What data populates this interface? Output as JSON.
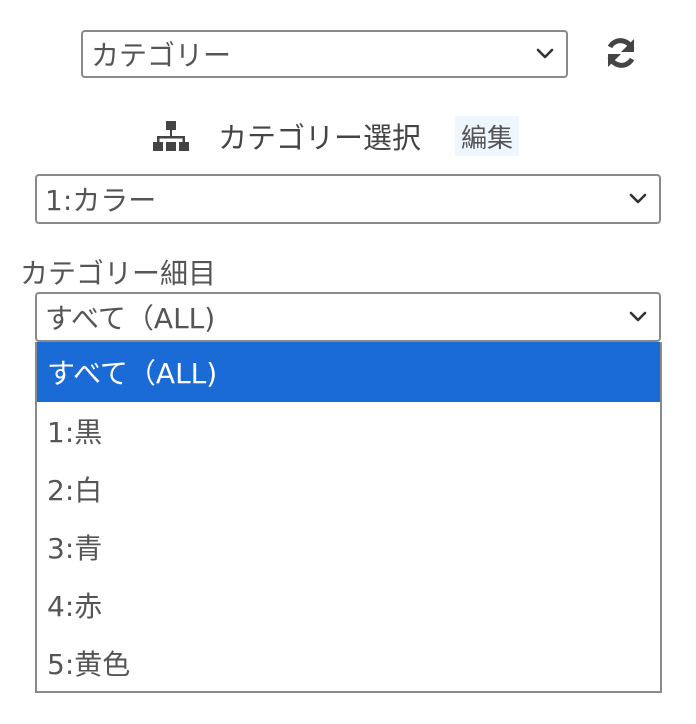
{
  "top_select": {
    "value": "カテゴリー"
  },
  "header": {
    "title": "カテゴリー選択",
    "edit_label": "編集"
  },
  "category_select": {
    "value": "1:カラー"
  },
  "detail": {
    "label": "カテゴリー細目",
    "value": "すべて（ALL)",
    "options": [
      "すべて（ALL)",
      "1:黒",
      "2:白",
      "3:青",
      "4:赤",
      "5:黄色"
    ],
    "selected_index": 0
  },
  "colors": {
    "highlight": "#1b6bd6",
    "edit_bg": "#eef7fd"
  },
  "icons": {
    "refresh": "refresh-icon",
    "tree": "sitemap-icon",
    "chevron": "chevron-down-icon"
  }
}
